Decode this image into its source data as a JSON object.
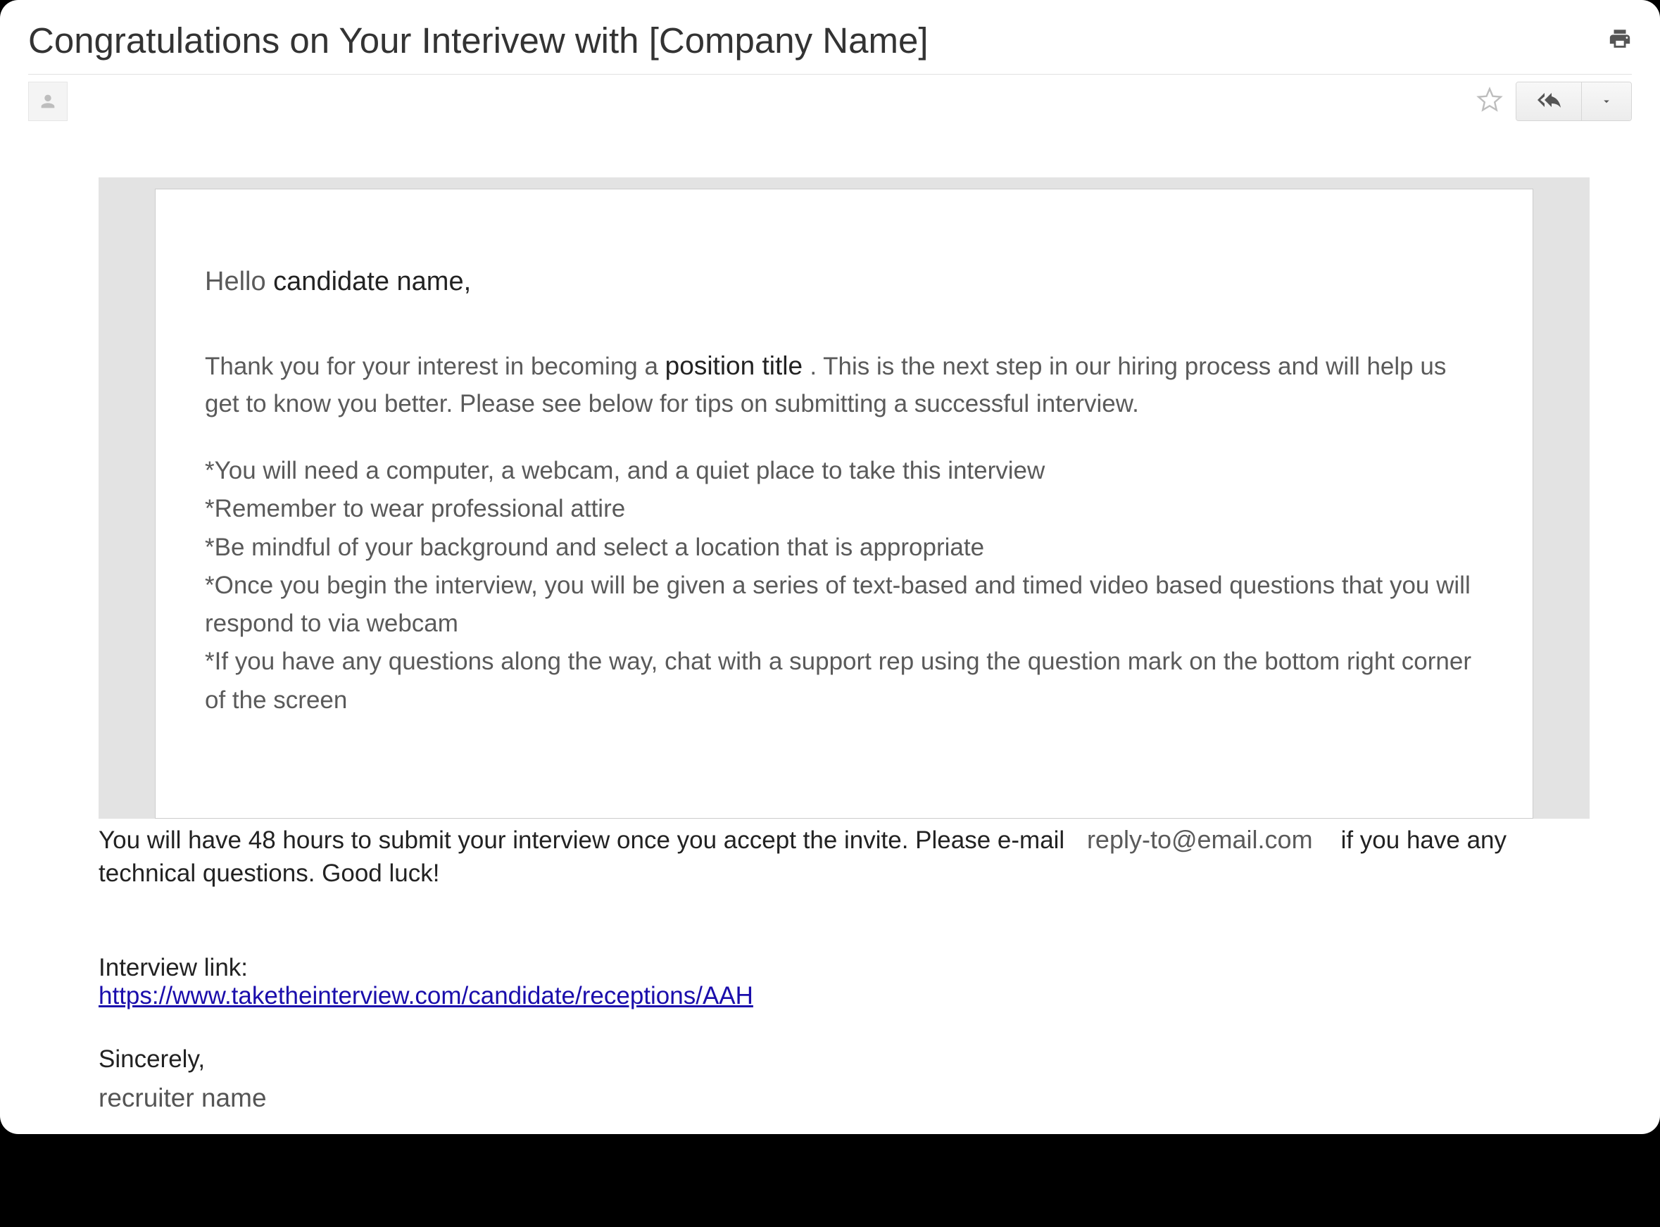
{
  "subject": "Congratulations on Your Interivew with [Company Name]",
  "greeting": {
    "hello": "Hello",
    "candidate": "candidate name,"
  },
  "paragraph": {
    "part1": "Thank you for your interest in becoming a ",
    "position": " position title   ",
    "part2": ". This is the next step in our hiring process and will help us get to know you better. Please see below for tips on submitting a successful interview."
  },
  "tips": {
    "t1": "*You will need a computer, a webcam, and a quiet place to take this interview",
    "t2": "*Remember to wear professional attire",
    "t3": "*Be mindful of your background and select a location that is appropriate",
    "t4": "*Once you begin the interview, you will be given a series of text-based and timed video based questions that you will respond to via webcam",
    "t5": "*If you have any questions along the way, chat with a support rep using the question mark on the bottom right corner of the screen"
  },
  "footer": {
    "part1": "You will have 48 hours to submit your interview once you accept the invite. Please e-mail ",
    "email": " reply-to@email.com ",
    "part2": " if you have any technical questions. Good luck!"
  },
  "link_label": "Interview link:",
  "link_url": "https://www.taketheinterview.com/candidate/receptions/AAH",
  "signoff": "Sincerely,",
  "recruiter": "recruiter name"
}
